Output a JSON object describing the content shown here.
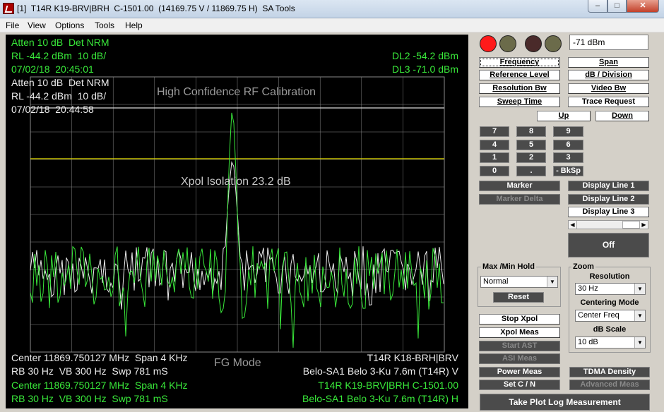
{
  "window": {
    "title": "[1]  T14R K19-BRV|BRH  C-1501.00  (14169.75 V / 11869.75 H)  SA Tools",
    "min": "–",
    "max": "□",
    "close": "✕"
  },
  "menu": [
    "File",
    "View",
    "Options",
    "Tools",
    "Help"
  ],
  "screen": {
    "green_top": [
      "Atten 10 dB  Det NRM",
      "RL -44.2 dBm  10 dB/",
      "07/02/18  20:45:01"
    ],
    "dl2": "DL2 -54.2 dBm",
    "dl3": "DL3 -71.0 dBm",
    "white_top": [
      "Atten 10 dB  Det NRM",
      "RL -44.2 dBm  10 dB/",
      "07/02/18  20:44:58"
    ],
    "plot_title": "High Confidence RF Calibration",
    "isolation": "Xpol Isolation 23.2 dB",
    "fg_mode": "FG Mode",
    "white_bottom_left": [
      "Center 11869.750127 MHz  Span 4 KHz",
      "RB 30 Hz  VB 300 Hz  Swp 781 mS"
    ],
    "white_bottom_right": [
      "T14R K18-BRH|BRV",
      "Belo-SA1 Belo 3-Ku 7.6m (T14R) V"
    ],
    "green_bottom_left": [
      "Center 11869.750127 MHz  Span 4 KHz",
      "RB 30 Hz  VB 300 Hz  Swp 781 mS"
    ],
    "green_bottom_right": [
      "T14R K19-BRV|BRH C-1501.00",
      "Belo-SA1 Belo 3-Ku 7.6m (T14R) H"
    ]
  },
  "colors": {
    "trace_green": "#39e83a",
    "trace_white": "#ececec",
    "display_line": "#e8e000",
    "grid": "#8a8a8a",
    "led_red": "#ff1a1a",
    "led_olive": "#6b6b4a",
    "led_maroon": "#4a2a2a"
  },
  "panel": {
    "readout": "-71 dBm",
    "leds": [
      "red",
      "olive",
      "maroon",
      "olive"
    ],
    "frequency": "Frequency",
    "span": "Span",
    "reference_level": "Reference Level",
    "db_division": "dB / Division",
    "resolution_bw": "Resolution Bw",
    "video_bw": "Video Bw",
    "sweep_time": "Sweep Time",
    "trace_request": "Trace Request",
    "up": "Up",
    "down": "Down",
    "keypad": [
      "7",
      "8",
      "9",
      "4",
      "5",
      "6",
      "1",
      "2",
      "3",
      "0",
      ".",
      "- BkSp"
    ],
    "marker": "Marker",
    "marker_delta": "Marker Delta",
    "display_line_1": "Display Line 1",
    "display_line_2": "Display Line 2",
    "display_line_3": "Display Line 3",
    "off": "Off",
    "maxmin_label": "Max /Min Hold",
    "maxmin_value": "Normal",
    "reset": "Reset",
    "zoom_label": "Zoom",
    "resolution_label": "Resolution",
    "resolution_value": "30 Hz",
    "centering_label": "Centering Mode",
    "centering_value": "Center Freq",
    "dbscale_label": "dB Scale",
    "dbscale_value": "10 dB",
    "stop_xpol": "Stop Xpol",
    "xpol_meas": "Xpol Meas",
    "start_ast": "Start AST",
    "asi_meas": "ASI Meas",
    "power_meas": "Power Meas",
    "tdma_density": "TDMA Density",
    "set_cn": "Set C / N",
    "advanced_meas": "Advanced Meas",
    "take_plot": "Take Plot Log Measurement"
  }
}
